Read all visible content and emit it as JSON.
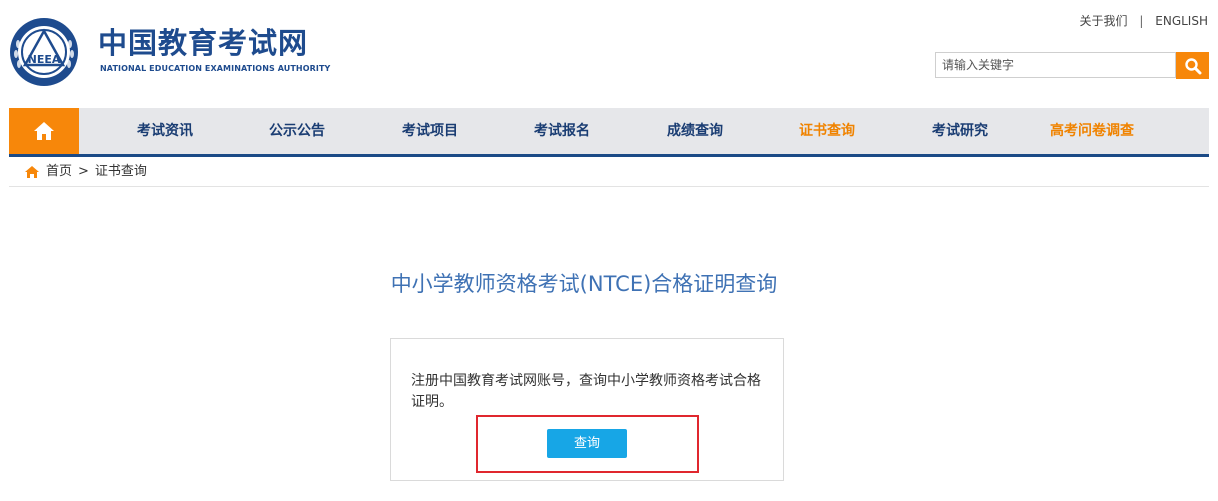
{
  "header": {
    "logo_text_cn": "中国教育考试网",
    "logo_text_en": "NATIONAL EDUCATION EXAMINATIONS AUTHORITY",
    "emblem_text": "NEEA",
    "top_links": [
      "关于我们",
      "ENGLISH"
    ],
    "top_separator": "|",
    "search": {
      "placeholder": "请输入关键字",
      "icon": "search-icon"
    }
  },
  "nav": {
    "home_icon": "home-icon",
    "items": [
      {
        "label": "考试资讯"
      },
      {
        "label": "公示公告"
      },
      {
        "label": "考试项目"
      },
      {
        "label": "考试报名"
      },
      {
        "label": "成绩查询"
      },
      {
        "label": "证书查询"
      },
      {
        "label": "考试研究"
      },
      {
        "label": "高考问卷调查"
      }
    ],
    "active_color": "#f08300",
    "normal_color": "#1a3d73"
  },
  "breadcrumb": {
    "icon": "home-icon",
    "home": "首页",
    "separator": ">",
    "current": "证书查询"
  },
  "main": {
    "title": "中小学教师资格考试(NTCE)合格证明查询",
    "card_text": "注册中国教育考试网账号，查询中小学教师资格考试合格证明。",
    "query_button": "查询"
  },
  "colors": {
    "brand_blue": "#1e4b8e",
    "accent_orange": "#f7870a",
    "button_blue": "#17a6e6",
    "highlight_red": "#e0272e"
  }
}
